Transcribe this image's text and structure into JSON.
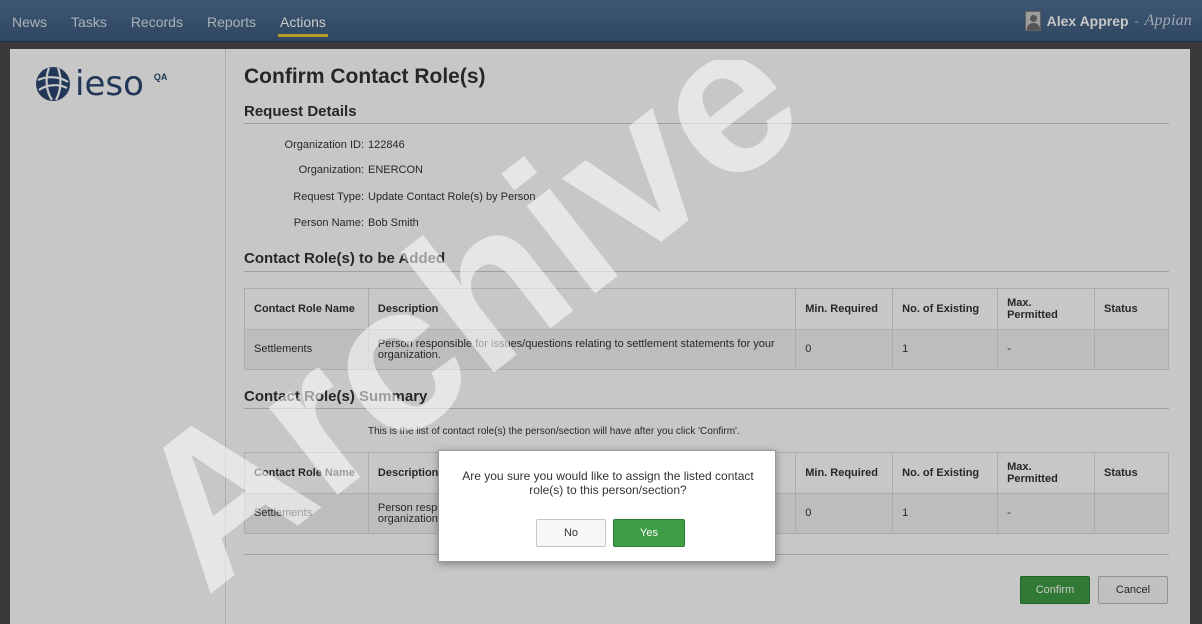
{
  "nav": {
    "tabs": [
      {
        "label": "News"
      },
      {
        "label": "Tasks"
      },
      {
        "label": "Records"
      },
      {
        "label": "Reports"
      },
      {
        "label": "Actions"
      }
    ],
    "active_tab": "Actions",
    "user_name": "Alex Apprep",
    "user_caret": "-",
    "brand": "Appian"
  },
  "logo": {
    "text": "ieso",
    "env": "QA"
  },
  "page": {
    "title": "Confirm Contact Role(s)",
    "request_details": {
      "heading": "Request Details",
      "fields": [
        {
          "label": "Organization ID:",
          "value": "122846"
        },
        {
          "label": "Organization:",
          "value": "ENERCON"
        },
        {
          "label": "Request Type:",
          "value": "Update Contact Role(s) by Person"
        },
        {
          "label": "Person Name:",
          "value": "Bob Smith"
        }
      ]
    },
    "roles_added": {
      "heading": "Contact Role(s) to be Added",
      "columns": [
        "Contact Role Name",
        "Description",
        "Min. Required",
        "No. of Existing",
        "Max. Permitted",
        "Status"
      ],
      "rows": [
        {
          "name": "Settlements",
          "description": "Person responsible for issues/questions relating to settlement statements for your organization.",
          "min": "0",
          "existing": "1",
          "max": "-",
          "status": ""
        }
      ]
    },
    "roles_summary": {
      "heading": "Contact Role(s) Summary",
      "note": "This is the list of contact role(s) the person/section will have after you click 'Confirm'.",
      "columns": [
        "Contact Role Name",
        "Description",
        "Min. Required",
        "No. of Existing",
        "Max. Permitted",
        "Status"
      ],
      "rows": [
        {
          "name": "Settlements",
          "description": "Person responsible for issues/questions relating to settlement statements for your organization.",
          "min": "0",
          "existing": "1",
          "max": "-",
          "status": ""
        }
      ]
    },
    "buttons": {
      "confirm": "Confirm",
      "cancel": "Cancel"
    }
  },
  "dialog": {
    "message": "Are you sure you would like to assign the listed contact role(s) to this person/section?",
    "no_label": "No",
    "yes_label": "Yes"
  },
  "watermark": {
    "text": "Archive"
  },
  "colors": {
    "nav_bg": "#46668a",
    "nav_active_underline": "#e8c83a",
    "primary_green": "#3e9d45",
    "logo_blue": "#2c4771"
  }
}
